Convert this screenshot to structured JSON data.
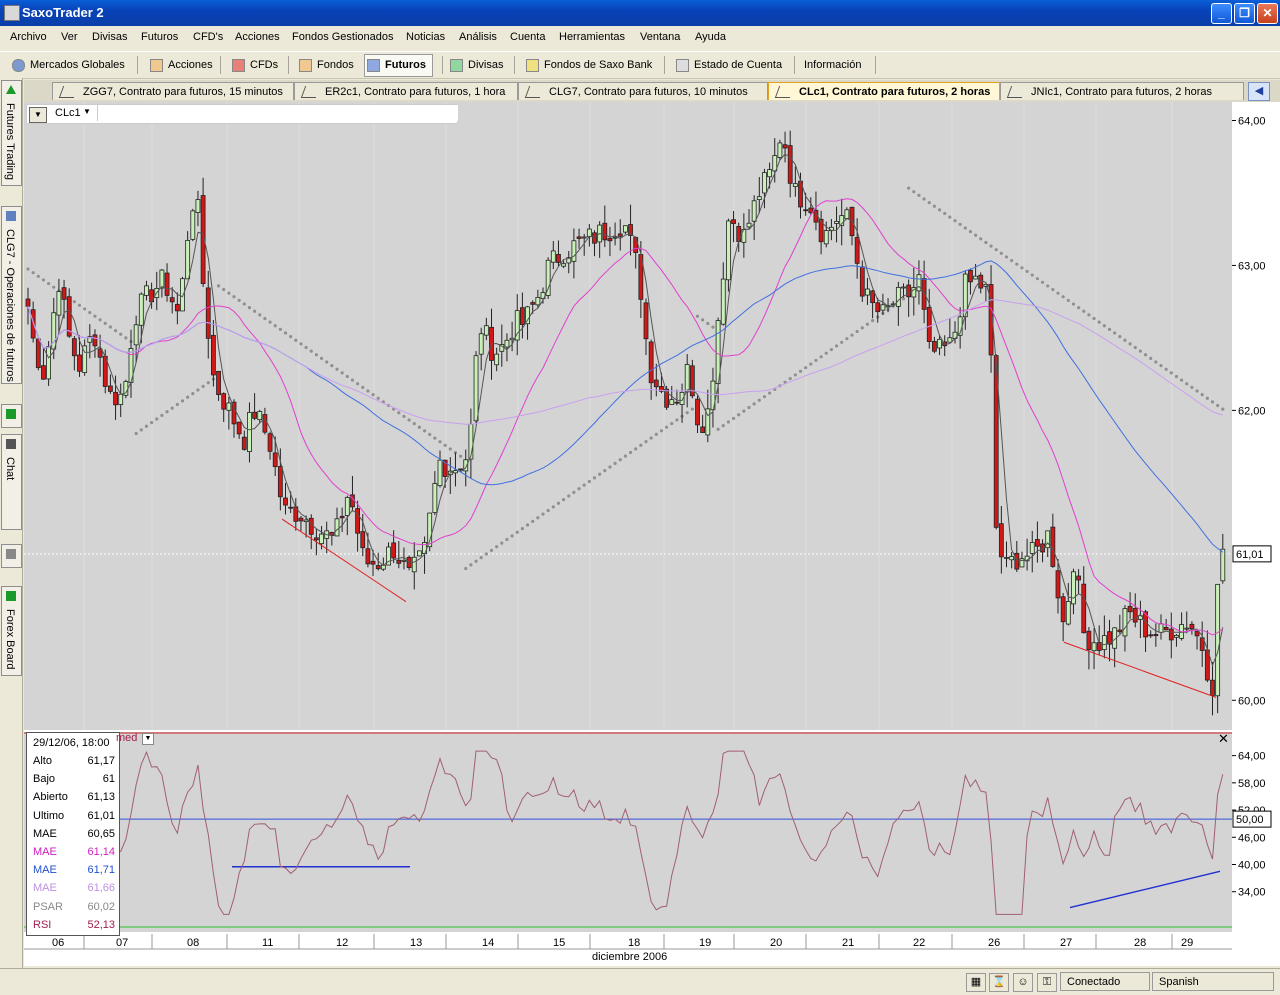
{
  "window": {
    "title": "SaxoTrader 2"
  },
  "menu": [
    "Archivo",
    "Ver",
    "Divisas",
    "Futuros",
    "CFD's",
    "Acciones",
    "Fondos Gestionados",
    "Noticias",
    "Análisis",
    "Cuenta",
    "Herramientas",
    "Ventana",
    "Ayuda"
  ],
  "nav": [
    {
      "label": "Mercados Globales",
      "icon": "globe-icon",
      "color": "#5a7ab0"
    },
    {
      "label": "Acciones",
      "icon": "stock-icon",
      "color": "#d88030"
    },
    {
      "label": "CFDs",
      "icon": "cfd-icon",
      "color": "#c83028"
    },
    {
      "label": "Fondos",
      "icon": "funds-icon",
      "color": "#d88030"
    },
    {
      "label": "Futuros",
      "icon": "futures-icon",
      "color": "#3050b0",
      "active": true
    },
    {
      "label": "Divisas",
      "icon": "forex-icon",
      "color": "#30a040"
    },
    {
      "label": "Fondos de Saxo Bank",
      "icon": "saxo-funds-icon",
      "color": "#d8c030"
    },
    {
      "label": "Estado de Cuenta",
      "icon": "account-icon",
      "color": "#555"
    },
    {
      "label": "Información",
      "icon": "",
      "color": ""
    }
  ],
  "tabs": [
    {
      "label": "ZGG7, Contrato para futuros, 15 minutos",
      "active": false
    },
    {
      "label": "ER2c1, Contrato para futuros, 1 hora",
      "active": false
    },
    {
      "label": "CLG7, Contrato para futuros, 10 minutos",
      "active": false
    },
    {
      "label": "CLc1, Contrato para futuros, 2 horas",
      "active": true
    },
    {
      "label": "JNIc1, Contrato para futuros, 2 horas",
      "active": false
    }
  ],
  "rail": [
    "Futures Trading",
    "CLG7 - Operaciones de futuros",
    "",
    "Chat",
    "",
    "Forex Board"
  ],
  "chart": {
    "symbol": "CLc1",
    "current_price": "61,01",
    "price_ticks": [
      "64,00",
      "63,00",
      "62,00",
      "60,00"
    ],
    "rsi_ticks": [
      "64,00",
      "58,00",
      "52,00",
      "46,00",
      "40,00",
      "34,00"
    ],
    "rsi_level": "50,00",
    "rsi_header": "med",
    "x_labels": [
      "06",
      "07",
      "08",
      "11",
      "12",
      "13",
      "14",
      "15",
      "18",
      "19",
      "20",
      "21",
      "22",
      "26",
      "27",
      "28",
      "29"
    ],
    "month_label": "diciembre 2006"
  },
  "info": {
    "date": "29/12/06, 18:00",
    "rows": [
      {
        "label": "Alto",
        "value": "61,17",
        "color": "#000"
      },
      {
        "label": "Bajo",
        "value": "61",
        "color": "#000"
      },
      {
        "label": "Abierto",
        "value": "61,13",
        "color": "#000"
      },
      {
        "label": "Ultimo",
        "value": "61,01",
        "color": "#000"
      },
      {
        "label": "MAE",
        "value": "60,65",
        "color": "#000"
      },
      {
        "label": "MAE",
        "value": "61,14",
        "color": "#d020c0"
      },
      {
        "label": "MAE",
        "value": "61,71",
        "color": "#2050d0"
      },
      {
        "label": "MAE",
        "value": "61,66",
        "color": "#c090e0"
      },
      {
        "label": "PSAR",
        "value": "60,02",
        "color": "#888"
      },
      {
        "label": "RSI",
        "value": "52,13",
        "color": "#a02050"
      }
    ]
  },
  "status": {
    "connection": "Conectado",
    "language": "Spanish"
  },
  "colors": {
    "up": "#c8f0b8",
    "down": "#d01818",
    "ma_fast": "#555555",
    "ma_mid": "#e040d0",
    "ma_blue": "#4070e0",
    "ma_lilac": "#c8a0f0",
    "psar": "#909090",
    "rsi": "#a06070"
  }
}
